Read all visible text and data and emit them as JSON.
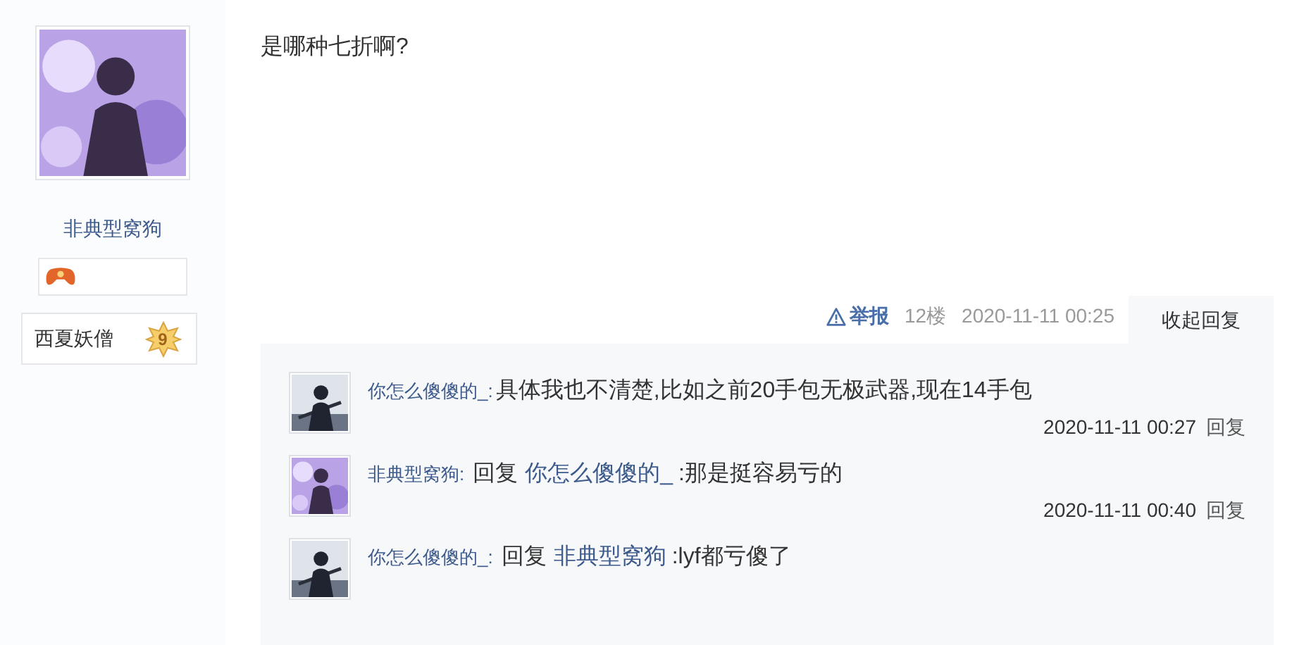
{
  "author": {
    "name": "非典型窝狗",
    "title": "西夏妖僧",
    "level": "9"
  },
  "post": {
    "content": "是哪种七折啊?",
    "report": "举报",
    "floor": "12楼",
    "time": "2020-11-11 00:25",
    "toggle_replies": "收起回复"
  },
  "replies": [
    {
      "user": "你怎么傻傻的_:",
      "text": "具体我也不清楚,比如之前20手包无极武器,现在14手包",
      "time": "2020-11-11 00:27",
      "reply": "回复"
    },
    {
      "user": "非典型窝狗:",
      "prefix": "回复",
      "target": "你怎么傻傻的_",
      "text": ":那是挺容易亏的",
      "time": "2020-11-11 00:40",
      "reply": "回复"
    },
    {
      "user": "你怎么傻傻的_:",
      "prefix": "回复",
      "target": "非典型窝狗",
      "text": ":lyf都亏傻了"
    }
  ]
}
